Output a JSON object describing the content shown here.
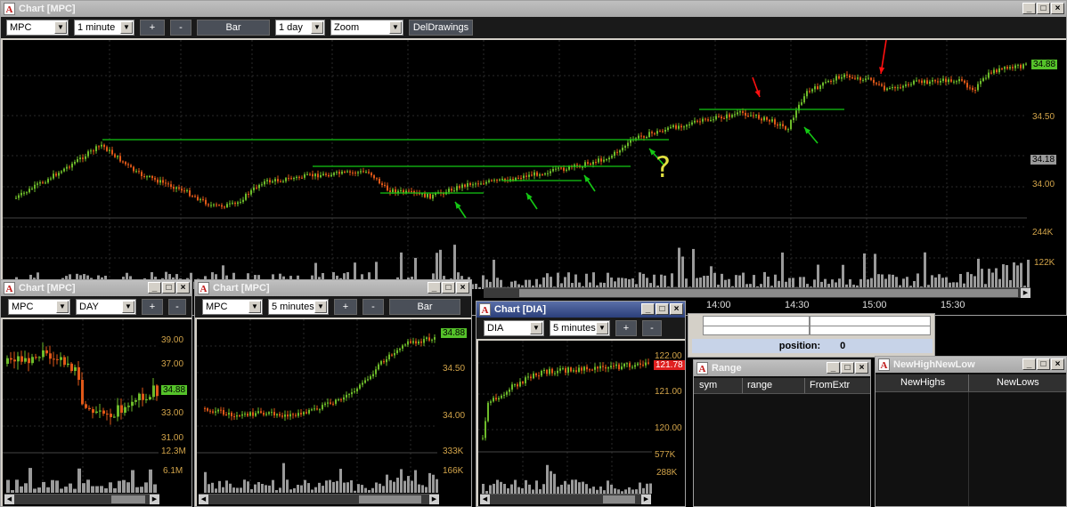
{
  "app_logo_letter": "A",
  "main_chart": {
    "title": "Chart [MPC]",
    "symbol": "MPC",
    "interval": "1 minute",
    "plus": "+",
    "minus": "-",
    "bar": "Bar",
    "range": "1 day",
    "zoom": "Zoom",
    "deldrawings": "DelDrawings",
    "price_labels": [
      "34.50",
      "34.00"
    ],
    "last_price": "34.88",
    "mid_price": "34.18",
    "volume_labels": [
      "244K",
      "122K"
    ],
    "time_labels": [
      "14:00",
      "14:30",
      "15:00",
      "15:30"
    ],
    "annotation": "?"
  },
  "chart_mpc_day": {
    "title": "Chart [MPC]",
    "symbol": "MPC",
    "interval": "DAY",
    "plus": "+",
    "minus": "-",
    "price_labels": [
      "39.00",
      "37.00",
      "33.00",
      "31.00"
    ],
    "last_price": "34.88",
    "volume_labels": [
      "12.3M",
      "6.1M"
    ]
  },
  "chart_mpc_5min": {
    "title": "Chart [MPC]",
    "symbol": "MPC",
    "interval": "5 minutes",
    "plus": "+",
    "minus": "-",
    "bar": "Bar",
    "price_labels": [
      "34.50",
      "34.00"
    ],
    "last_price": "34.88",
    "volume_labels": [
      "333K",
      "166K"
    ]
  },
  "chart_dia": {
    "title": "Chart [DIA]",
    "symbol": "DIA",
    "interval": "5 minutes",
    "plus": "+",
    "minus": "-",
    "price_labels": [
      "122.00",
      "121.00",
      "120.00"
    ],
    "last_price": "121.78",
    "volume_labels": [
      "577K",
      "288K"
    ]
  },
  "position_panel": {
    "label": "position:",
    "value": "0"
  },
  "range_window": {
    "title": "Range",
    "columns": [
      "sym",
      "range",
      "FromExtr"
    ]
  },
  "newhighnewlow_window": {
    "title": "NewHighNewLow",
    "columns": [
      "NewHighs",
      "NewLows"
    ]
  },
  "window_buttons": {
    "min": "_",
    "max": "□",
    "close": "×"
  },
  "colors": {
    "up": "#6dbb2a",
    "down": "#e05818",
    "level": "#14c814",
    "arrow_green": "#14c814",
    "arrow_red": "#ff1010",
    "price_label": "#d2a44a",
    "last_bg": "#55c22a",
    "dia_last_bg": "#e02020"
  }
}
